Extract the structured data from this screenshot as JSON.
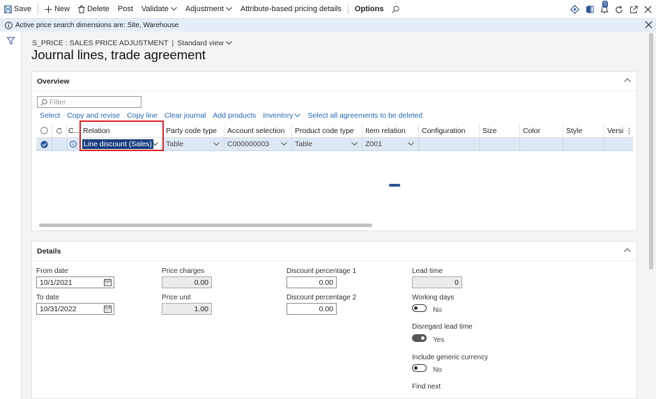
{
  "toolbar": {
    "save": "Save",
    "new": "New",
    "delete": "Delete",
    "post": "Post",
    "validate": "Validate",
    "adjustment": "Adjustment",
    "attribute_pricing": "Attribute-based pricing details",
    "options": "Options",
    "notification_count": "0",
    "icons": [
      "save-icon",
      "plus-icon",
      "delete-icon",
      "chevron-down-icon",
      "search-icon",
      "diamond-icon",
      "office-icon",
      "notification-icon",
      "refresh-icon",
      "open-new-window-icon",
      "close-icon"
    ]
  },
  "message": {
    "text": "Active price search dimensions are: Site, Warehouse"
  },
  "breadcrumb": {
    "path": "S_PRICE : SALES PRICE ADJUSTMENT",
    "separator": "|",
    "view": "Standard view"
  },
  "page": {
    "title": "Journal lines, trade agreement"
  },
  "overview": {
    "title": "Overview",
    "filter_placeholder": "Filter",
    "actions": {
      "select": "Select",
      "copy_and_revise": "Copy and revise",
      "copy_line": "Copy line",
      "clear_journal": "Clear journal",
      "add_products": "Add products",
      "inventory": "Inventory",
      "select_all_delete": "Select all agreements to be deleted"
    },
    "columns": {
      "c": "C...",
      "relation": "Relation",
      "party_code_type": "Party code type",
      "account_selection": "Account selection",
      "product_code_type": "Product code type",
      "item_relation": "Item relation",
      "configuration": "Configuration",
      "size": "Size",
      "color": "Color",
      "style": "Style",
      "version": "Versi"
    },
    "row": {
      "relation": "Line discount (Sales)",
      "party_code_type": "Table",
      "account_selection": "C000000003",
      "product_code_type": "Table",
      "item_relation": "Z001",
      "configuration": "",
      "size": "",
      "color": "",
      "style": "",
      "version": ""
    }
  },
  "details": {
    "title": "Details",
    "from_date_label": "From date",
    "from_date": "10/1/2021",
    "to_date_label": "To date",
    "to_date": "10/31/2022",
    "price_charges_label": "Price charges",
    "price_charges": "0.00",
    "price_unit_label": "Price unit",
    "price_unit": "1.00",
    "discount1_label": "Discount percentage 1",
    "discount1": "0.00",
    "discount2_label": "Discount percentage 2",
    "discount2": "0.00",
    "lead_time_label": "Lead time",
    "lead_time": "0",
    "working_days_label": "Working days",
    "working_days": "No",
    "disregard_lead_time_label": "Disregard lead time",
    "disregard_lead_time": "Yes",
    "generic_currency_label": "Include generic currency",
    "generic_currency": "No",
    "find_next_label": "Find next"
  },
  "colors": {
    "accent": "#2266b3",
    "selection": "#19407d",
    "highlight_box": "#e01f26",
    "message_bg": "#e4eef8",
    "row_selected": "#dde8f5"
  }
}
